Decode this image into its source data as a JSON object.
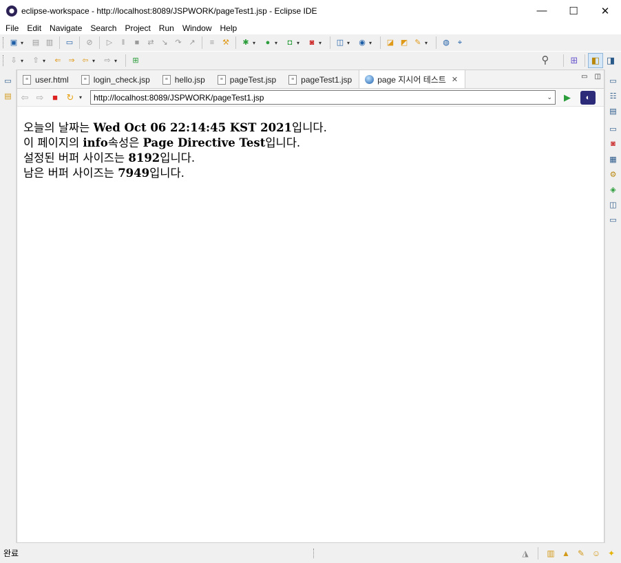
{
  "window": {
    "title": "eclipse-workspace - http://localhost:8089/JSPWORK/pageTest1.jsp - Eclipse IDE",
    "controls": [
      "—",
      "☐",
      "✕"
    ]
  },
  "menu": [
    "File",
    "Edit",
    "Navigate",
    "Search",
    "Project",
    "Run",
    "Window",
    "Help"
  ],
  "tabs": [
    {
      "label": "user.html",
      "icon": "file-icon"
    },
    {
      "label": "login_check.jsp",
      "icon": "file-icon"
    },
    {
      "label": "hello.jsp",
      "icon": "file-icon"
    },
    {
      "label": "pageTest.jsp",
      "icon": "file-icon"
    },
    {
      "label": "pageTest1.jsp",
      "icon": "file-icon"
    },
    {
      "label": "page 지시어 테스트",
      "icon": "globe-icon",
      "active": true
    }
  ],
  "browser": {
    "url": "http://localhost:8089/JSPWORK/pageTest1.jsp"
  },
  "content": {
    "line1": {
      "prefix": "오늘의 날짜는 ",
      "value": "Wed Oct 06 22:14:45 KST 2021",
      "suffix": "입니다."
    },
    "line2": {
      "prefix": "이 페이지의 ",
      "value": "info",
      "middle": "속성은 ",
      "value2": "Page Directive Test",
      "suffix": "입니다."
    },
    "line3": {
      "prefix": "설정된 버퍼 사이즈는 ",
      "value": "8192",
      "suffix": "입니다."
    },
    "line4": {
      "prefix": "남은 버퍼 사이즈는 ",
      "value": "7949",
      "suffix": "입니다."
    }
  },
  "status": {
    "text": "완료"
  },
  "colors": {
    "accent": "#2c2255",
    "stop": "#dd2222",
    "run": "#2a9d3a"
  }
}
